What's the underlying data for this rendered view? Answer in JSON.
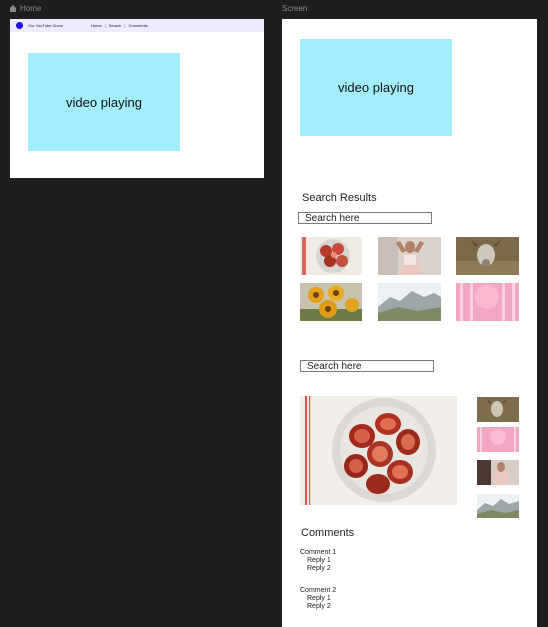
{
  "frames": {
    "home_label": "Home",
    "screen_label": "Screen"
  },
  "home": {
    "brand": "Our YouTube Clone",
    "nav": [
      "Home",
      "Search",
      "Comments"
    ],
    "video_label": "video playing"
  },
  "screen": {
    "video_label": "video playing",
    "search_results_title": "Search Results",
    "search_placeholder": "Search here",
    "search_placeholder_2": "Search here",
    "thumbnails": [
      {
        "name": "figs-thumb"
      },
      {
        "name": "woman-portrait-thumb"
      },
      {
        "name": "goat-thumb"
      },
      {
        "name": "sunflowers-thumb"
      },
      {
        "name": "mountain-thumb"
      },
      {
        "name": "pink-balloon-thumb"
      }
    ],
    "comments_title": "Comments",
    "comments": [
      {
        "text": "Comment 1",
        "replies": [
          "Reply 1",
          "Reply 2"
        ]
      },
      {
        "text": "Comment 2",
        "replies": [
          "Reply 1",
          "Reply 2"
        ]
      }
    ]
  },
  "colors": {
    "canvas_bg": "#1e1e1e",
    "video_placeholder": "#a2eefe",
    "nav_bg": "#ecebff",
    "logo": "#1a0fd6"
  }
}
